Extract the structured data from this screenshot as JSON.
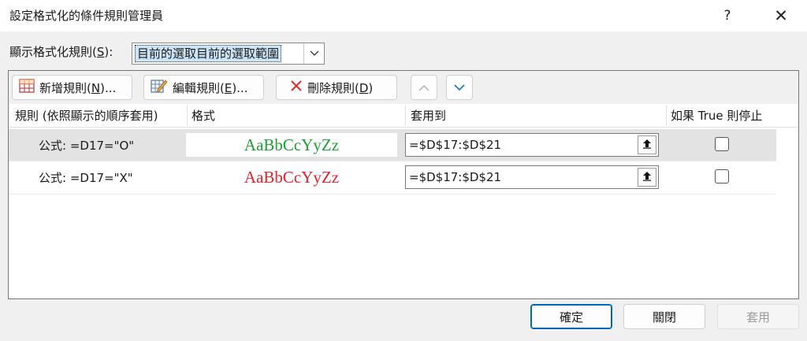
{
  "dialog": {
    "title": "設定格式化的條件規則管理員",
    "help_glyph": "?",
    "close_glyph": "✕"
  },
  "show_rules": {
    "label_prefix": "顯示格式化規則(",
    "label_key": "S",
    "label_suffix": "):",
    "value": "目前的選取目前的選取範圍"
  },
  "toolbar": {
    "new_rule": {
      "prefix": "新增規則(",
      "key": "N",
      "suffix": ")..."
    },
    "edit_rule": {
      "prefix": "編輯規則(",
      "key": "E",
      "suffix": ")..."
    },
    "delete_rule": {
      "prefix": "刪除規則(",
      "key": "D",
      "suffix": ")"
    }
  },
  "columns": {
    "rule": "規則 (依照顯示的順序套用)",
    "format": "格式",
    "applies_to": "套用到",
    "stop_if_true": "如果 True 則停止"
  },
  "rules": [
    {
      "description": "公式: =D17=\"O\"",
      "preview": "AaBbCcYyZz",
      "preview_color": "#1aa232",
      "applies_to": "=$D$17:$D$21",
      "stop_if_true": false,
      "selected": true
    },
    {
      "description": "公式: =D17=\"X\"",
      "preview": "AaBbCcYyZz",
      "preview_color": "#e8202a",
      "applies_to": "=$D$17:$D$21",
      "stop_if_true": false,
      "selected": false
    }
  ],
  "buttons": {
    "ok": "確定",
    "close": "關閉",
    "apply": "套用"
  },
  "colors": {
    "accent": "#0067c0",
    "selection": "#cce4f7"
  }
}
